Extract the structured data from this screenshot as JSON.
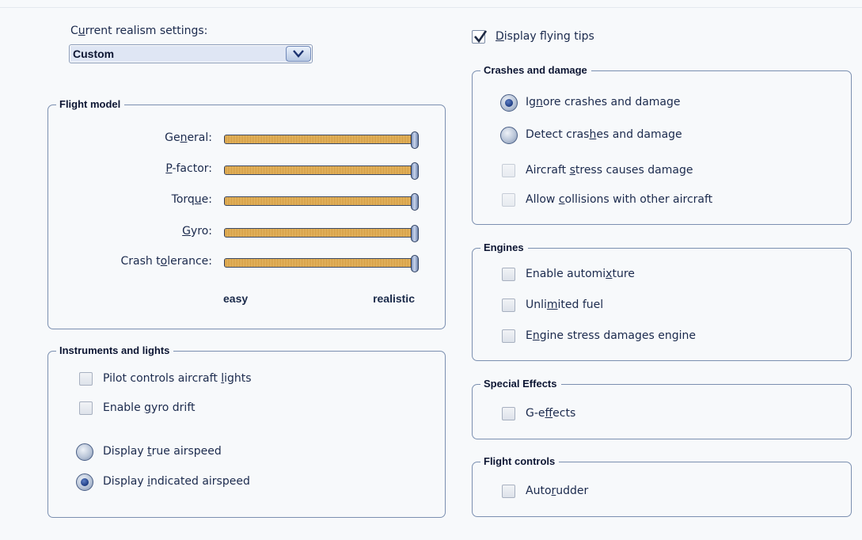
{
  "realism": {
    "label_before": "C",
    "label_mnemonic": "u",
    "label_after": "rrent realism settings:",
    "selected": "Custom"
  },
  "tips": {
    "pre": "",
    "mn": "D",
    "post": "isplay flying tips",
    "checked": true
  },
  "flight_model": {
    "title": "Flight model",
    "sliders": [
      {
        "pre": "Ge",
        "mn": "n",
        "post": "eral:",
        "value": 1.0
      },
      {
        "pre": "",
        "mn": "P",
        "post": "-factor:",
        "value": 1.0
      },
      {
        "pre": "Torq",
        "mn": "u",
        "post": "e:",
        "value": 1.0
      },
      {
        "pre": "",
        "mn": "G",
        "post": "yro:",
        "value": 1.0
      },
      {
        "pre": "Crash t",
        "mn": "o",
        "post": "lerance:",
        "value": 1.0
      }
    ],
    "scale_min": "easy",
    "scale_max": "realistic"
  },
  "instruments": {
    "title": "Instruments and lights",
    "checkboxes": [
      {
        "pre": "Pilot controls aircraft ",
        "mn": "l",
        "post": "ights",
        "checked": false
      },
      {
        "pre": "Enable ",
        "mn": "g",
        "post": "yro drift",
        "checked": false
      }
    ],
    "radios": [
      {
        "pre": "Display ",
        "mn": "t",
        "post": "rue airspeed",
        "selected": false
      },
      {
        "pre": "Display ",
        "mn": "i",
        "post": "ndicated airspeed",
        "selected": true
      }
    ]
  },
  "crashes": {
    "title": "Crashes and damage",
    "radios": [
      {
        "pre": "Ig",
        "mn": "n",
        "post": "ore crashes and damage",
        "selected": true
      },
      {
        "pre": "Detect cras",
        "mn": "h",
        "post": "es and damage",
        "selected": false
      }
    ],
    "checkboxes": [
      {
        "pre": "Aircraft ",
        "mn": "s",
        "post": "tress causes damage",
        "checked": false
      },
      {
        "pre": "Allow ",
        "mn": "c",
        "post": "ollisions with other aircraft",
        "checked": false
      }
    ]
  },
  "engines": {
    "title": "Engines",
    "checkboxes": [
      {
        "pre": "Enable automi",
        "mn": "x",
        "post": "ture",
        "checked": false
      },
      {
        "pre": "Unli",
        "mn": "m",
        "post": "ited fuel",
        "checked": false
      },
      {
        "pre": "E",
        "mn": "n",
        "post": "gine stress damages engine",
        "checked": false
      }
    ]
  },
  "effects": {
    "title": "Special Effects",
    "checkboxes": [
      {
        "pre": "G-e",
        "mn": "f",
        "post": "fects",
        "checked": false
      }
    ]
  },
  "controls": {
    "title": "Flight controls",
    "checkboxes": [
      {
        "pre": "Auto",
        "mn": "r",
        "post": "udder",
        "checked": false
      }
    ]
  }
}
